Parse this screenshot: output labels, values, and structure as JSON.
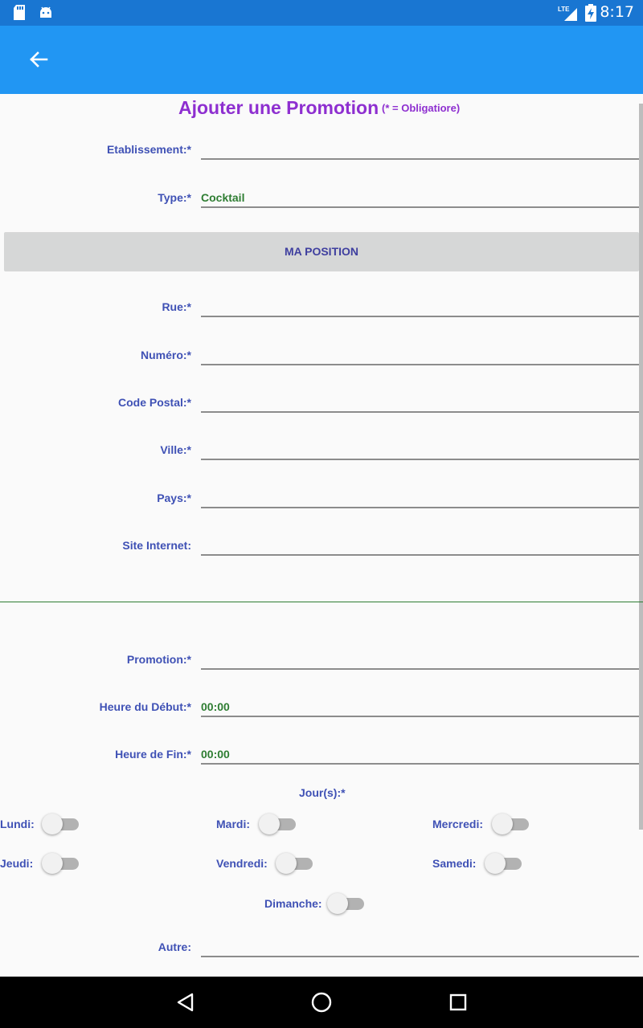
{
  "status_bar": {
    "time": "8:17",
    "network": "LTE",
    "icons": [
      "sd-card-icon",
      "android-icon",
      "lte-signal-icon",
      "battery-charging-icon"
    ]
  },
  "app_bar": {
    "back_icon": "arrow-left-icon"
  },
  "form": {
    "title": "Ajouter une Promotion",
    "title_note": "(* = Obligatiore)",
    "etablissement": {
      "label": "Etablissement:*",
      "value": ""
    },
    "type": {
      "label": "Type:*",
      "value": "Cocktail"
    },
    "position_button": "MA POSITION",
    "rue": {
      "label": "Rue:*",
      "value": ""
    },
    "numero": {
      "label": "Numéro:*",
      "value": ""
    },
    "code_postal": {
      "label": "Code Postal:*",
      "value": ""
    },
    "ville": {
      "label": "Ville:*",
      "value": ""
    },
    "pays": {
      "label": "Pays:*",
      "value": ""
    },
    "site": {
      "label": "Site Internet:",
      "value": ""
    },
    "promotion": {
      "label": "Promotion:*",
      "value": ""
    },
    "heure_debut": {
      "label": "Heure du Début:*",
      "value": "00:00"
    },
    "heure_fin": {
      "label": "Heure de Fin:*",
      "value": "00:00"
    },
    "jours_label": "Jour(s):*",
    "days": {
      "lundi": {
        "label": "Lundi:",
        "checked": false
      },
      "mardi": {
        "label": "Mardi:",
        "checked": false
      },
      "mercredi": {
        "label": "Mercredi:",
        "checked": false
      },
      "jeudi": {
        "label": "Jeudi:",
        "checked": false
      },
      "vendredi": {
        "label": "Vendredi:",
        "checked": false
      },
      "samedi": {
        "label": "Samedi:",
        "checked": false
      },
      "dimanche": {
        "label": "Dimanche:",
        "checked": false
      }
    },
    "autre": {
      "label": "Autre:",
      "value": ""
    }
  },
  "nav_bar": {
    "icons": [
      "back-triangle-icon",
      "home-circle-icon",
      "recents-square-icon"
    ]
  },
  "colors": {
    "status_bar": "#1976d2",
    "app_bar": "#2196f3",
    "title": "#8e2fd0",
    "label": "#3f51b5",
    "value": "#2e7d32"
  }
}
